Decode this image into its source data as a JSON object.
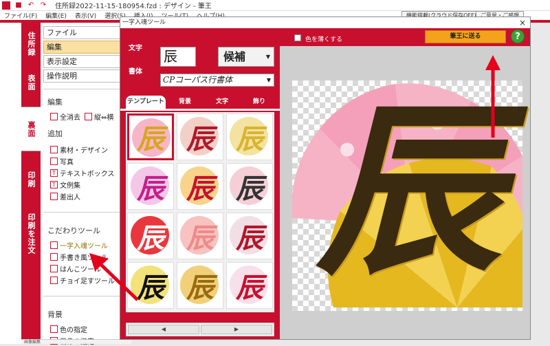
{
  "window": {
    "title": "住所録2022-11-15-180954.fzd : デザイン - 筆王"
  },
  "menubar": {
    "items": [
      "ファイル(F)",
      "編集(E)",
      "表示(V)",
      "選択(S)",
      "挿入(I)",
      "ツール(T)",
      "ヘルプ(H)"
    ],
    "cloud_pill": "機能搭載(クラウド保存OFF)",
    "login_pill": "ご意見・ご感想"
  },
  "vtabs": [
    "住所録",
    "表面",
    "裏面",
    "印刷",
    "印刷を注文"
  ],
  "leftpanel": {
    "menu": [
      "ファイル",
      "編集",
      "表示設定",
      "操作説明"
    ],
    "edit_heading": "編集",
    "clear_all": "全消去",
    "flip": "縦⇔横",
    "add_heading": "追加",
    "add_items": [
      "素材・デザイン",
      "写真",
      "テキストボックス",
      "文例集",
      "差出人"
    ],
    "special_heading": "こだわりツール",
    "special_items": [
      "一字入魂ツール",
      "手書き風ツール",
      "はんこツール",
      "チョイ足すツール"
    ],
    "bg_heading": "背景",
    "bg_items": [
      "色の指定",
      "画像の指定"
    ],
    "status_text": "画像編集"
  },
  "dialog": {
    "title": "一字入魂ツール",
    "close": "×",
    "char_label": "文字",
    "char_value": "辰",
    "candidates_label": "候補",
    "font_label": "書体",
    "font_value": "CPコーパス行書体",
    "tabs": [
      "テンプレート",
      "背景",
      "文字",
      "飾り"
    ],
    "thumb_char": "辰",
    "pager_prev": "◀",
    "pager_next": "▶",
    "fade_label": "色を薄くする",
    "send_button": "筆王に送る",
    "help_button": "?",
    "preview_char": "辰"
  },
  "colors": {
    "brand_red": "#c8102e",
    "send_orange": "#f4a21c",
    "help_green": "#3aa335",
    "annotation_red": "#e3001b",
    "gold": "#d9b430",
    "pink": "#f3a8c0"
  },
  "thumbnails": [
    {
      "bg": "#f6b6c8",
      "fg": "#d9a520"
    },
    {
      "bg": "#f2d0c8",
      "fg": "#b0182a"
    },
    {
      "bg": "#f3e2a0",
      "fg": "#d9b430"
    },
    {
      "bg": "#f4c7e8",
      "fg": "#c31f8a"
    },
    {
      "bg": "#f7d48a",
      "fg": "#c8102e"
    },
    {
      "bg": "#f6cfd6",
      "fg": "#333333"
    },
    {
      "bg": "#e8383d",
      "fg": "#ffffff"
    },
    {
      "bg": "#f7c2c0",
      "fg": "#f08a8a"
    },
    {
      "bg": "#f2dfe6",
      "fg": "#b0182a"
    },
    {
      "bg": "#f3e27a",
      "fg": "#111111"
    },
    {
      "bg": "#f2d07a",
      "fg": "#9a6a10"
    },
    {
      "bg": "#f7e0ea",
      "fg": "#c8102e"
    }
  ]
}
